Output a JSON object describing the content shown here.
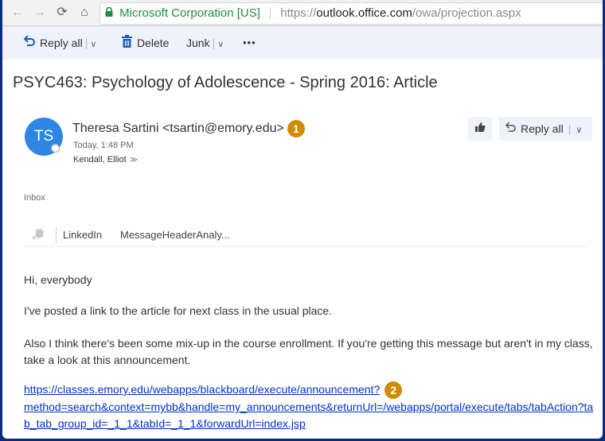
{
  "browser": {
    "nav": {
      "back": "←",
      "forward": "→",
      "reload": "⟳",
      "home": "⌂"
    },
    "secure_label": "Microsoft Corporation [US]",
    "url_scheme": "https://",
    "url_host": "outlook.office.com",
    "url_path": "/owa/projection.aspx"
  },
  "toolbar": {
    "reply_all_label": "Reply all",
    "delete_label": "Delete",
    "junk_label": "Junk",
    "more_label": "•••",
    "separator": "|",
    "chevron": "∨"
  },
  "message": {
    "subject": "PSYC463: Psychology of Adolescence - Spring 2016: Article",
    "avatar_initials": "TS",
    "sender": "Theresa Sartini <tsartin@emory.edu>",
    "badge_1": "1",
    "time": "Today, 1:48 PM",
    "recipient": "Kendall, Elliot",
    "recipient_expand": "≫",
    "reply_all_label": "Reply all",
    "folder": "Inbox",
    "addins": [
      "LinkedIn",
      "MessageHeaderAnaly..."
    ],
    "body": {
      "greeting": "Hi, everybody",
      "para1": "I've posted a link to the article for next class in the usual place.",
      "para2": "Also I think there's been some mix-up in the course enrollment. If you're getting this message but aren't in my class, take a look at this announcement.",
      "link_line1": "https://classes.emory.edu/webapps/blackboard/execute/announcement?",
      "link_line2": "method=search&context=mybb&handle=my_announcements&returnUrl=/webapps/portal/execute/tabs/tabAction?tab_tab_group_id=_1_1&tabId=_1_1&forwardUrl=index.jsp",
      "badge_2": "2"
    }
  },
  "colors": {
    "accent": "#1a5fb4",
    "badge": "#d08b00",
    "avatar": "#2f87e3",
    "link": "#0033cc",
    "secure": "#1e8e3e"
  }
}
